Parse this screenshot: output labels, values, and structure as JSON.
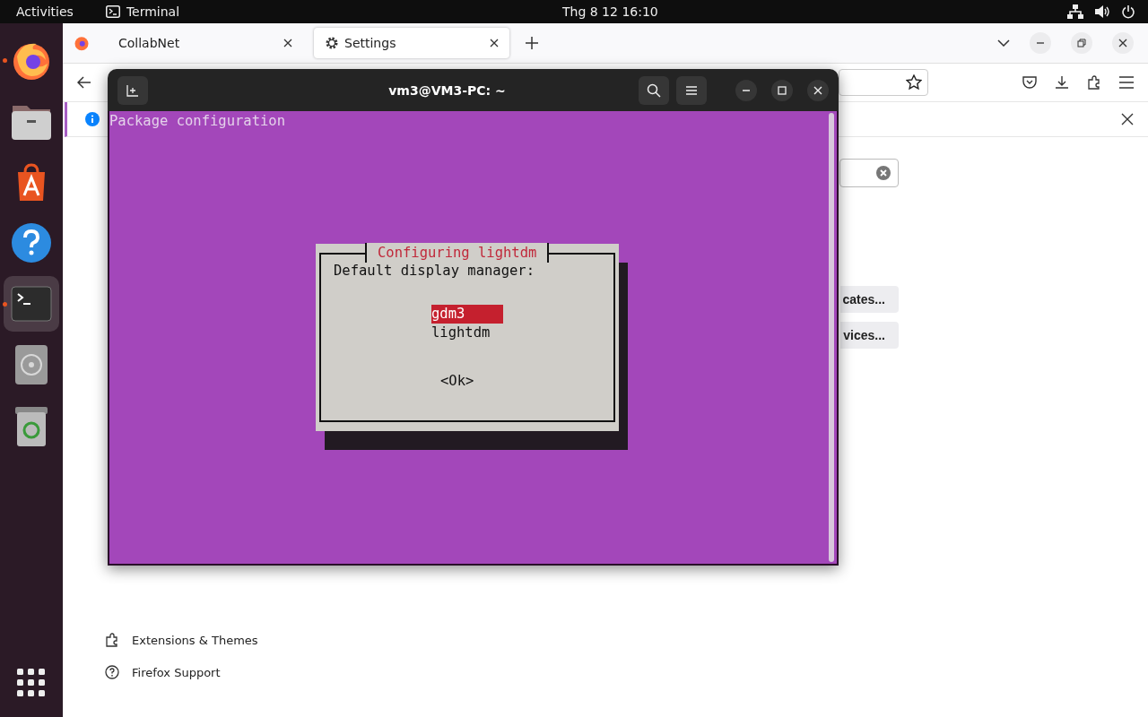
{
  "top_bar": {
    "activities": "Activities",
    "app": "Terminal",
    "clock": "Thg 8 12  16:10"
  },
  "dock": {
    "items": [
      {
        "kind": "firefox",
        "running": true,
        "selected": false
      },
      {
        "kind": "files",
        "running": false,
        "selected": false
      },
      {
        "kind": "store",
        "running": false,
        "selected": false
      },
      {
        "kind": "help",
        "running": false,
        "selected": false
      },
      {
        "kind": "terminal",
        "running": true,
        "selected": true
      },
      {
        "kind": "disc",
        "running": false,
        "selected": false
      },
      {
        "kind": "trash",
        "running": false,
        "selected": false
      }
    ]
  },
  "browser": {
    "tabs": [
      {
        "label": "CollabNet",
        "selected": false,
        "kind": "plain"
      },
      {
        "label": "Settings",
        "selected": true,
        "kind": "settings"
      }
    ],
    "content": {
      "buttons": [
        "cates...",
        "vices..."
      ],
      "links": [
        {
          "label": "Extensions & Themes",
          "kind": "extensions"
        },
        {
          "label": "Firefox Support",
          "kind": "support"
        }
      ]
    }
  },
  "terminal": {
    "title": "vm3@VM3-PC: ~",
    "header": "Package configuration",
    "dialog": {
      "title": "Configuring lightdm",
      "prompt": "Default display manager:",
      "options": [
        {
          "label": "gdm3",
          "selected": true
        },
        {
          "label": "lightdm",
          "selected": false
        }
      ],
      "button": "<Ok>"
    }
  }
}
